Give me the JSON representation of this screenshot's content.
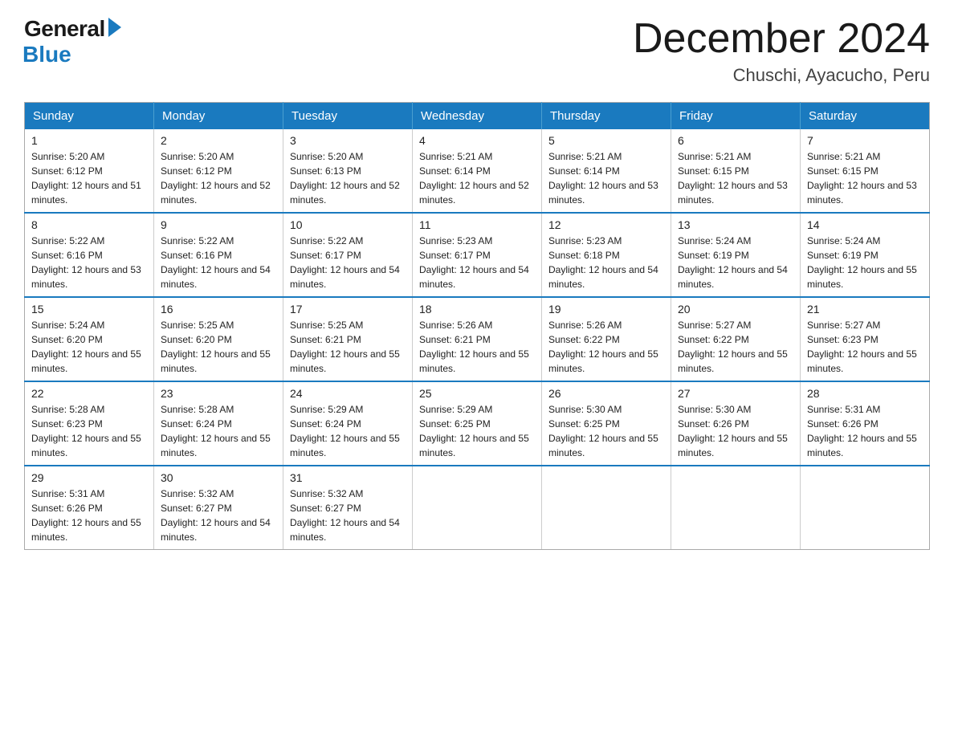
{
  "header": {
    "logo_general": "General",
    "logo_blue": "Blue",
    "title": "December 2024",
    "location": "Chuschi, Ayacucho, Peru"
  },
  "calendar": {
    "days_of_week": [
      "Sunday",
      "Monday",
      "Tuesday",
      "Wednesday",
      "Thursday",
      "Friday",
      "Saturday"
    ],
    "weeks": [
      [
        {
          "day": "1",
          "sunrise": "5:20 AM",
          "sunset": "6:12 PM",
          "daylight": "12 hours and 51 minutes."
        },
        {
          "day": "2",
          "sunrise": "5:20 AM",
          "sunset": "6:12 PM",
          "daylight": "12 hours and 52 minutes."
        },
        {
          "day": "3",
          "sunrise": "5:20 AM",
          "sunset": "6:13 PM",
          "daylight": "12 hours and 52 minutes."
        },
        {
          "day": "4",
          "sunrise": "5:21 AM",
          "sunset": "6:14 PM",
          "daylight": "12 hours and 52 minutes."
        },
        {
          "day": "5",
          "sunrise": "5:21 AM",
          "sunset": "6:14 PM",
          "daylight": "12 hours and 53 minutes."
        },
        {
          "day": "6",
          "sunrise": "5:21 AM",
          "sunset": "6:15 PM",
          "daylight": "12 hours and 53 minutes."
        },
        {
          "day": "7",
          "sunrise": "5:21 AM",
          "sunset": "6:15 PM",
          "daylight": "12 hours and 53 minutes."
        }
      ],
      [
        {
          "day": "8",
          "sunrise": "5:22 AM",
          "sunset": "6:16 PM",
          "daylight": "12 hours and 53 minutes."
        },
        {
          "day": "9",
          "sunrise": "5:22 AM",
          "sunset": "6:16 PM",
          "daylight": "12 hours and 54 minutes."
        },
        {
          "day": "10",
          "sunrise": "5:22 AM",
          "sunset": "6:17 PM",
          "daylight": "12 hours and 54 minutes."
        },
        {
          "day": "11",
          "sunrise": "5:23 AM",
          "sunset": "6:17 PM",
          "daylight": "12 hours and 54 minutes."
        },
        {
          "day": "12",
          "sunrise": "5:23 AM",
          "sunset": "6:18 PM",
          "daylight": "12 hours and 54 minutes."
        },
        {
          "day": "13",
          "sunrise": "5:24 AM",
          "sunset": "6:19 PM",
          "daylight": "12 hours and 54 minutes."
        },
        {
          "day": "14",
          "sunrise": "5:24 AM",
          "sunset": "6:19 PM",
          "daylight": "12 hours and 55 minutes."
        }
      ],
      [
        {
          "day": "15",
          "sunrise": "5:24 AM",
          "sunset": "6:20 PM",
          "daylight": "12 hours and 55 minutes."
        },
        {
          "day": "16",
          "sunrise": "5:25 AM",
          "sunset": "6:20 PM",
          "daylight": "12 hours and 55 minutes."
        },
        {
          "day": "17",
          "sunrise": "5:25 AM",
          "sunset": "6:21 PM",
          "daylight": "12 hours and 55 minutes."
        },
        {
          "day": "18",
          "sunrise": "5:26 AM",
          "sunset": "6:21 PM",
          "daylight": "12 hours and 55 minutes."
        },
        {
          "day": "19",
          "sunrise": "5:26 AM",
          "sunset": "6:22 PM",
          "daylight": "12 hours and 55 minutes."
        },
        {
          "day": "20",
          "sunrise": "5:27 AM",
          "sunset": "6:22 PM",
          "daylight": "12 hours and 55 minutes."
        },
        {
          "day": "21",
          "sunrise": "5:27 AM",
          "sunset": "6:23 PM",
          "daylight": "12 hours and 55 minutes."
        }
      ],
      [
        {
          "day": "22",
          "sunrise": "5:28 AM",
          "sunset": "6:23 PM",
          "daylight": "12 hours and 55 minutes."
        },
        {
          "day": "23",
          "sunrise": "5:28 AM",
          "sunset": "6:24 PM",
          "daylight": "12 hours and 55 minutes."
        },
        {
          "day": "24",
          "sunrise": "5:29 AM",
          "sunset": "6:24 PM",
          "daylight": "12 hours and 55 minutes."
        },
        {
          "day": "25",
          "sunrise": "5:29 AM",
          "sunset": "6:25 PM",
          "daylight": "12 hours and 55 minutes."
        },
        {
          "day": "26",
          "sunrise": "5:30 AM",
          "sunset": "6:25 PM",
          "daylight": "12 hours and 55 minutes."
        },
        {
          "day": "27",
          "sunrise": "5:30 AM",
          "sunset": "6:26 PM",
          "daylight": "12 hours and 55 minutes."
        },
        {
          "day": "28",
          "sunrise": "5:31 AM",
          "sunset": "6:26 PM",
          "daylight": "12 hours and 55 minutes."
        }
      ],
      [
        {
          "day": "29",
          "sunrise": "5:31 AM",
          "sunset": "6:26 PM",
          "daylight": "12 hours and 55 minutes."
        },
        {
          "day": "30",
          "sunrise": "5:32 AM",
          "sunset": "6:27 PM",
          "daylight": "12 hours and 54 minutes."
        },
        {
          "day": "31",
          "sunrise": "5:32 AM",
          "sunset": "6:27 PM",
          "daylight": "12 hours and 54 minutes."
        },
        null,
        null,
        null,
        null
      ]
    ]
  }
}
